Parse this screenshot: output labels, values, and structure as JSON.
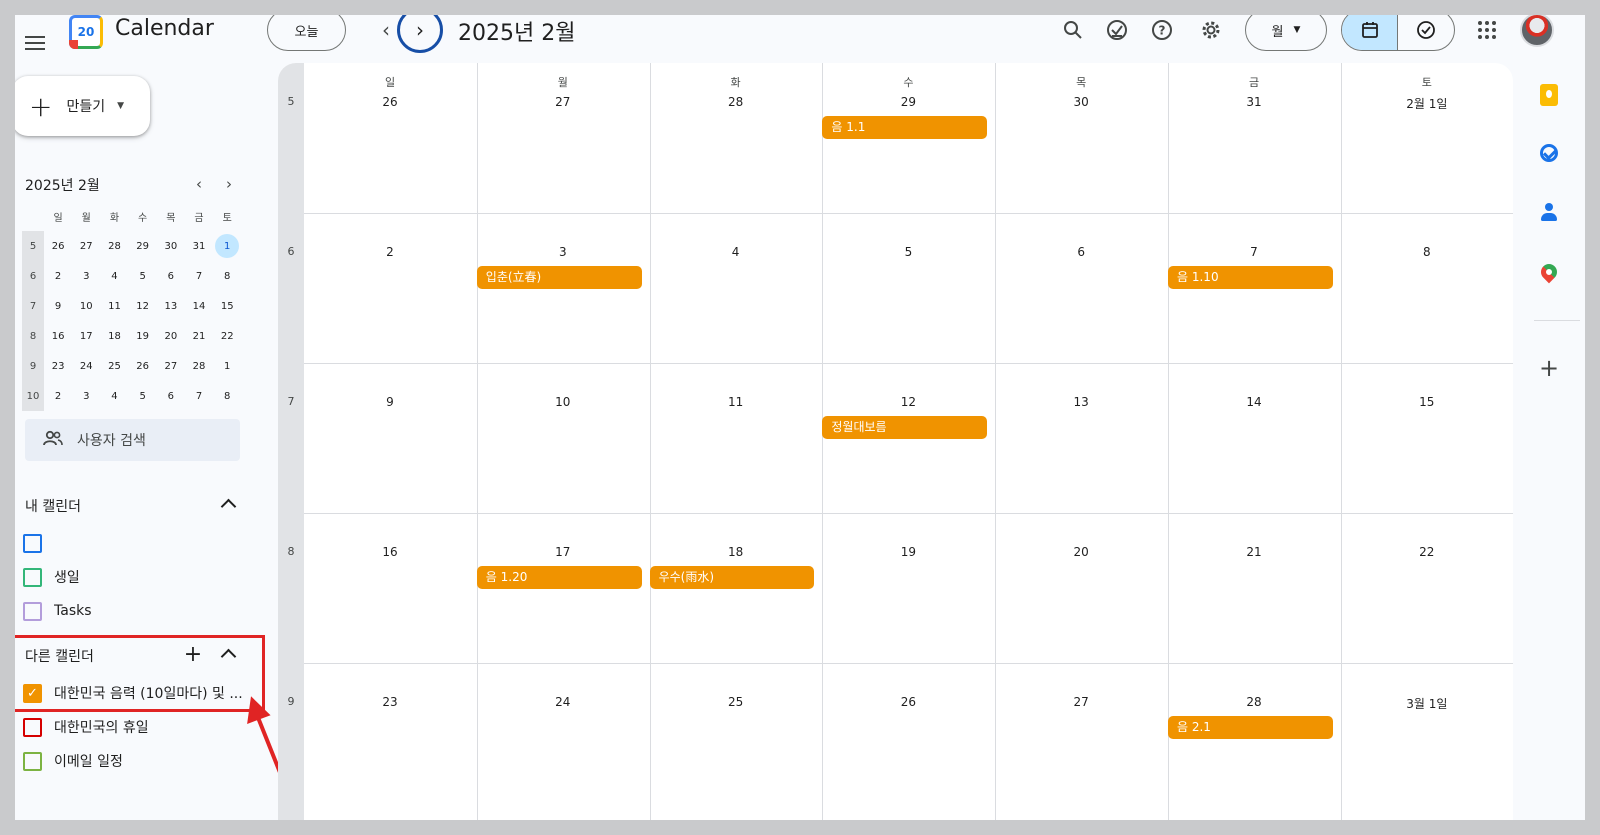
{
  "header": {
    "app_title": "Calendar",
    "logo_text": "20",
    "today_label": "오늘",
    "month_title": "2025년 2월",
    "view_label": "월"
  },
  "icons": {
    "menu": "menu-icon",
    "prev": "chevron-left-icon",
    "next": "chevron-right-icon",
    "search": "search-icon",
    "tasks": "task-check-icon",
    "help": "help-icon",
    "settings": "gear-icon",
    "calendar_mode": "calendar-icon",
    "tasks_mode": "check-circle-icon",
    "apps": "apps-grid-icon"
  },
  "sidebar": {
    "create_label": "만들기",
    "mini_title": "2025년 2월",
    "mini_headers": [
      "일",
      "월",
      "화",
      "수",
      "목",
      "금",
      "토"
    ],
    "mini_weeks": [
      {
        "week": "5",
        "days": [
          "26",
          "27",
          "28",
          "29",
          "30",
          "31",
          "1"
        ]
      },
      {
        "week": "6",
        "days": [
          "2",
          "3",
          "4",
          "5",
          "6",
          "7",
          "8"
        ]
      },
      {
        "week": "7",
        "days": [
          "9",
          "10",
          "11",
          "12",
          "13",
          "14",
          "15"
        ]
      },
      {
        "week": "8",
        "days": [
          "16",
          "17",
          "18",
          "19",
          "20",
          "21",
          "22"
        ]
      },
      {
        "week": "9",
        "days": [
          "23",
          "24",
          "25",
          "26",
          "27",
          "28",
          "1"
        ]
      },
      {
        "week": "10",
        "days": [
          "2",
          "3",
          "4",
          "5",
          "6",
          "7",
          "8"
        ]
      }
    ],
    "mini_selected": "1",
    "people_search": "사용자 검색",
    "my_calendars_title": "내 캘린더",
    "my_calendars": [
      {
        "label": "",
        "color": "#1a73e8",
        "checked": false
      },
      {
        "label": "생일",
        "color": "#33b679",
        "checked": false
      },
      {
        "label": "Tasks",
        "color": "#b39ddb",
        "checked": false
      }
    ],
    "other_calendars_title": "다른 캘린더",
    "other_calendars": [
      {
        "label": "대한민국 음력 (10일마다) 및 ...",
        "color": "#f09300",
        "checked": true
      },
      {
        "label": "대한민국의 휴일",
        "color": "#d50000",
        "checked": false
      },
      {
        "label": "이메일 일정",
        "color": "#7cb342",
        "checked": false
      }
    ]
  },
  "month": {
    "weekdays": [
      "일",
      "월",
      "화",
      "수",
      "목",
      "금",
      "토"
    ],
    "weeks": [
      {
        "week": "5",
        "days": [
          "26",
          "27",
          "28",
          "29",
          "30",
          "31",
          "2월 1일"
        ]
      },
      {
        "week": "6",
        "days": [
          "2",
          "3",
          "4",
          "5",
          "6",
          "7",
          "8"
        ]
      },
      {
        "week": "7",
        "days": [
          "9",
          "10",
          "11",
          "12",
          "13",
          "14",
          "15"
        ]
      },
      {
        "week": "8",
        "days": [
          "16",
          "17",
          "18",
          "19",
          "20",
          "21",
          "22"
        ]
      },
      {
        "week": "9",
        "days": [
          "23",
          "24",
          "25",
          "26",
          "27",
          "28",
          "3월 1일"
        ]
      }
    ],
    "events": [
      {
        "week": 0,
        "day": 3,
        "title": "음 1.1"
      },
      {
        "week": 1,
        "day": 1,
        "title": "입춘(立春)"
      },
      {
        "week": 1,
        "day": 5,
        "title": "음 1.10"
      },
      {
        "week": 2,
        "day": 3,
        "title": "정월대보름"
      },
      {
        "week": 3,
        "day": 1,
        "title": "음 1.20"
      },
      {
        "week": 3,
        "day": 2,
        "title": "우수(雨水)"
      },
      {
        "week": 4,
        "day": 5,
        "title": "음 2.1"
      }
    ],
    "event_color": "#f09300"
  },
  "rail": {
    "keep": "keep-icon",
    "tasks": "tasks-icon",
    "contacts": "contacts-icon",
    "maps": "maps-icon",
    "add": "plus-icon"
  },
  "annotation": {
    "color": "#e02424"
  }
}
